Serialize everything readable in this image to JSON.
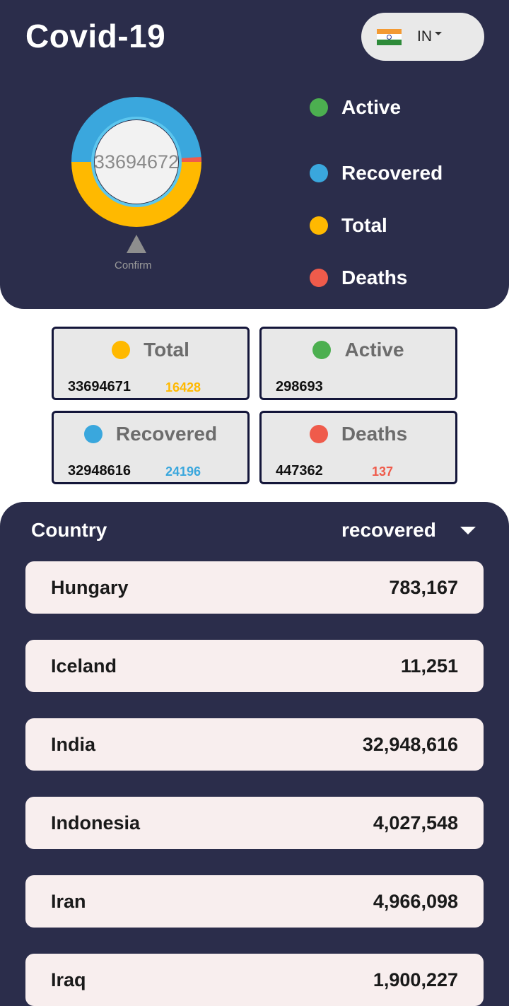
{
  "app": {
    "title": "Covid-19"
  },
  "country_selector": {
    "code": "IN",
    "flag": "india-flag-icon"
  },
  "donut": {
    "center_value": "33694672",
    "label": "Confirm",
    "segments": {
      "total": 33694671,
      "active": 298693,
      "recovered": 32948616,
      "deaths": 447362
    }
  },
  "legend": [
    {
      "label": "Active",
      "color": "#4caf50"
    },
    {
      "label": "Recovered",
      "color": "#3aa7dd"
    },
    {
      "label": "Total",
      "color": "#ffb900"
    },
    {
      "label": "Deaths",
      "color": "#ef5b4b"
    }
  ],
  "cards": {
    "total": {
      "title": "Total",
      "value": "33694671",
      "delta": "16428",
      "color": "#ffb900",
      "delta_color": "#ffb900"
    },
    "active": {
      "title": "Active",
      "value": "298693",
      "delta": "",
      "color": "#4caf50"
    },
    "recovered": {
      "title": "Recovered",
      "value": "32948616",
      "delta": "24196",
      "color": "#3aa7dd",
      "delta_color": "#3aa7dd"
    },
    "deaths": {
      "title": "Deaths",
      "value": "447362",
      "delta": "137",
      "color": "#ef5b4b",
      "delta_color": "#ef5b4b"
    }
  },
  "list": {
    "header_country": "Country",
    "sort_by": "recovered",
    "rows": [
      {
        "country": "Hungary",
        "value": "783,167"
      },
      {
        "country": "Iceland",
        "value": "11,251"
      },
      {
        "country": "India",
        "value": "32,948,616"
      },
      {
        "country": "Indonesia",
        "value": "4,027,548"
      },
      {
        "country": "Iran",
        "value": "4,966,098"
      },
      {
        "country": "Iraq",
        "value": "1,900,227"
      }
    ]
  }
}
